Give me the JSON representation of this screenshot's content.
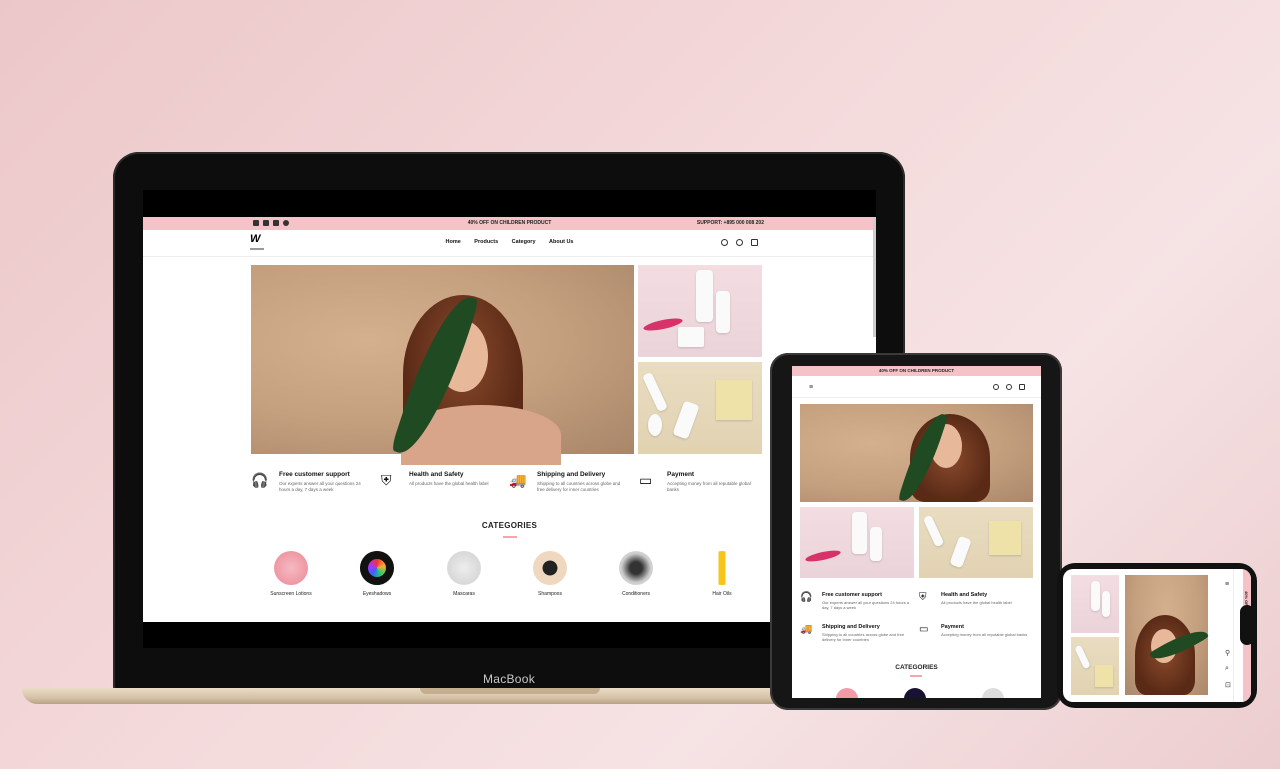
{
  "laptop": {
    "brand": "MacBook",
    "site": {
      "promo": {
        "message": "40% OFF ON CHILDREN PRODUCT",
        "support": "SUPPORT: +895 000 008 202"
      },
      "nav": {
        "logo": "W",
        "menu": [
          "Home",
          "Products",
          "Category",
          "About Us"
        ]
      },
      "features": [
        {
          "title": "Free customer support",
          "desc": "Our experts answer all your questions 24 hours a day, 7 days a week",
          "icon": "headset-icon",
          "glyph": "🎧"
        },
        {
          "title": "Health and Safety",
          "desc": "All products have the global health label",
          "icon": "shield-icon",
          "glyph": "⛨"
        },
        {
          "title": "Shipping and Delivery",
          "desc": "Shipping to all countries across globe and free delivery for inner countries",
          "icon": "truck-icon",
          "glyph": "🚚"
        },
        {
          "title": "Payment",
          "desc": "Accepting money from all reputable global banks",
          "icon": "card-icon",
          "glyph": "▭"
        }
      ],
      "categories_title": "CATEGORIES",
      "categories": [
        {
          "label": "Sunscreen Lotions",
          "color": "#f29aa6"
        },
        {
          "label": "Eyeshadows",
          "color": "#1a1233"
        },
        {
          "label": "Mascaras",
          "color": "#d8d8d8"
        },
        {
          "label": "Shampoos",
          "color": "#f0d8c0"
        },
        {
          "label": "Conditioners",
          "color": "#cfcfcf"
        },
        {
          "label": "Hair Oils",
          "color": "#ffffff"
        }
      ]
    }
  },
  "tablet": {
    "promo": "40% OFF ON CHILDREN PRODUCT",
    "features": [
      {
        "title": "Free customer support",
        "desc": "Our experts answer all your questions 24 hours a day, 7 days a week"
      },
      {
        "title": "Health and Safety",
        "desc": "All products have the global health label"
      },
      {
        "title": "Shipping and Delivery",
        "desc": "Shipping to all countries across globe and free delivery for inner countries"
      },
      {
        "title": "Payment",
        "desc": "Accepting money from all reputable global banks"
      }
    ],
    "categories_title": "CATEGORIES"
  },
  "phone": {
    "promo": "40% OFF"
  },
  "colors": {
    "accent_pink": "#f5c3c7",
    "background": "#f4dadb"
  }
}
